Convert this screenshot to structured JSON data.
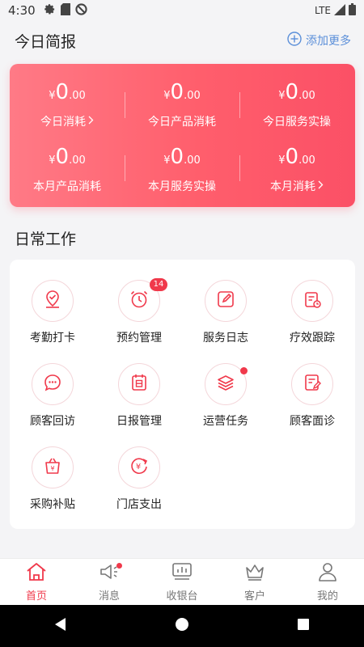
{
  "status_bar": {
    "time": "4:30",
    "network": "LTE"
  },
  "header": {
    "title": "今日简报",
    "add_more_label": "添加更多"
  },
  "stats": [
    {
      "currency": "¥",
      "integer": "0",
      "decimal": ".00",
      "label": "今日消耗",
      "arrow": true
    },
    {
      "currency": "¥",
      "integer": "0",
      "decimal": ".00",
      "label": "今日产品消耗",
      "arrow": false
    },
    {
      "currency": "¥",
      "integer": "0",
      "decimal": ".00",
      "label": "今日服务实操",
      "arrow": false
    },
    {
      "currency": "¥",
      "integer": "0",
      "decimal": ".00",
      "label": "本月产品消耗",
      "arrow": false
    },
    {
      "currency": "¥",
      "integer": "0",
      "decimal": ".00",
      "label": "本月服务实操",
      "arrow": false
    },
    {
      "currency": "¥",
      "integer": "0",
      "decimal": ".00",
      "label": "本月消耗",
      "arrow": true
    }
  ],
  "daily_work": {
    "title": "日常工作",
    "items": [
      {
        "label": "考勤打卡",
        "icon": "attendance-checkin-icon"
      },
      {
        "label": "预约管理",
        "icon": "alarm-clock-icon",
        "badge": "14"
      },
      {
        "label": "服务日志",
        "icon": "edit-log-icon"
      },
      {
        "label": "疗效跟踪",
        "icon": "report-clock-icon"
      },
      {
        "label": "顾客回访",
        "icon": "chat-bubble-icon"
      },
      {
        "label": "日报管理",
        "icon": "daily-report-icon"
      },
      {
        "label": "运营任务",
        "icon": "layers-icon",
        "dot": true
      },
      {
        "label": "顾客面诊",
        "icon": "consult-note-icon"
      },
      {
        "label": "采购补贴",
        "icon": "shopping-bag-icon"
      },
      {
        "label": "门店支出",
        "icon": "yen-expense-icon"
      }
    ]
  },
  "tabbar": [
    {
      "label": "首页",
      "icon": "home-icon",
      "active": true
    },
    {
      "label": "消息",
      "icon": "megaphone-icon",
      "dot": true
    },
    {
      "label": "收银台",
      "icon": "cashier-icon"
    },
    {
      "label": "客户",
      "icon": "crown-icon"
    },
    {
      "label": "我的",
      "icon": "user-icon"
    }
  ],
  "colors": {
    "accent": "#f0394b",
    "card_gradient_start": "#ff7a86",
    "card_gradient_end": "#fb5066",
    "link": "#5b8fd9"
  }
}
